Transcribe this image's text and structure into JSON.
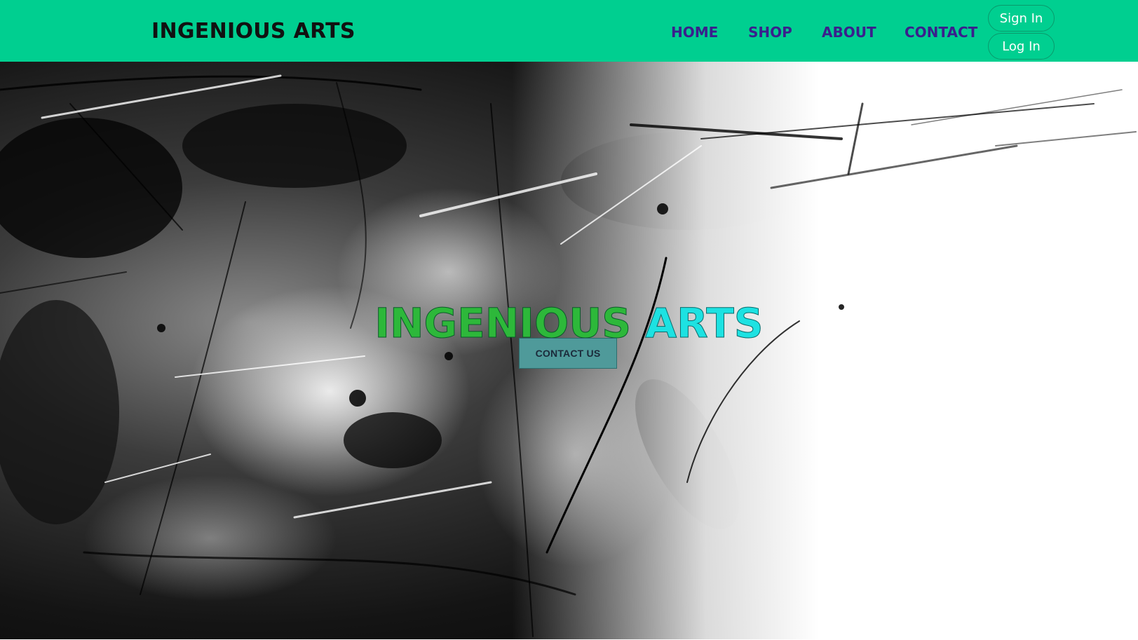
{
  "header": {
    "brand": "INGENIOUS ARTS",
    "nav": [
      {
        "label": "HOME"
      },
      {
        "label": "SHOP"
      },
      {
        "label": "ABOUT"
      },
      {
        "label": "CONTACT"
      }
    ],
    "sign_in_label": "Sign In",
    "log_in_label": "Log In"
  },
  "hero": {
    "title_word_1": "INGENIOUS",
    "title_word_2": "ARTS",
    "cta_label": "CONTACT US"
  },
  "colors": {
    "navbar_bg": "#00cf90",
    "nav_link": "#3a1f8c",
    "title_green": "#2db83a",
    "title_cyan": "#1de2e2",
    "cta_bg": "#4f9a9a"
  }
}
